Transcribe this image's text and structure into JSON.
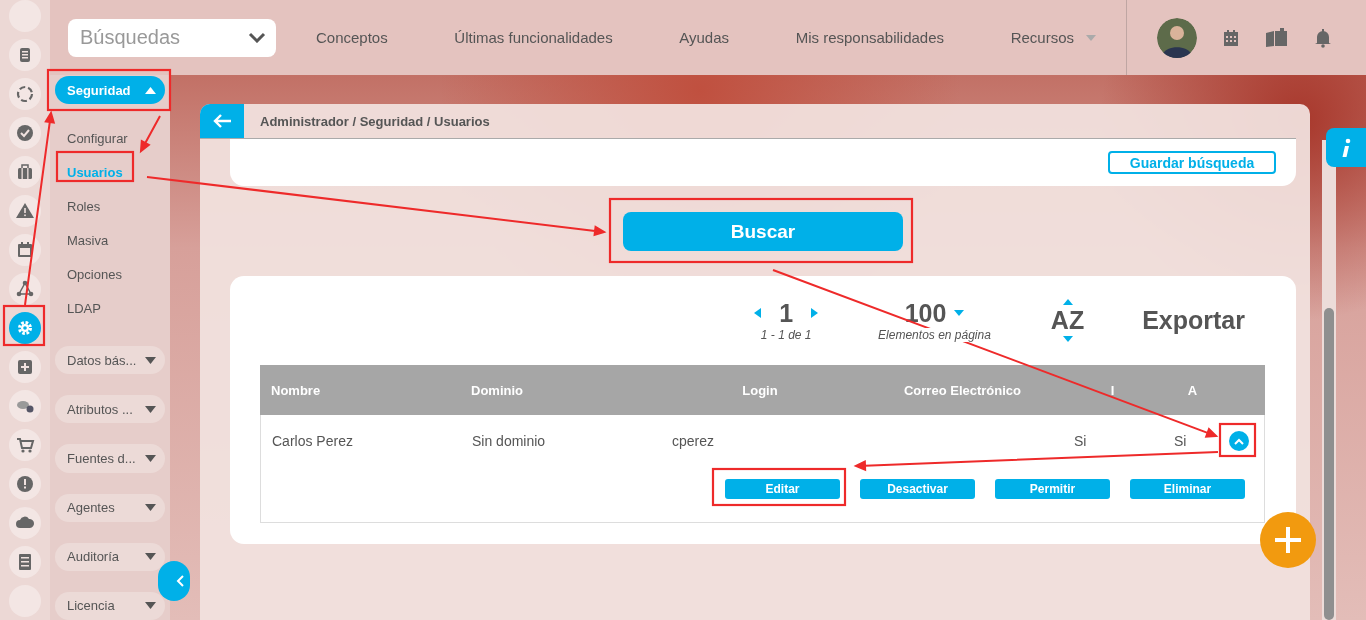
{
  "icon_rail": [
    {
      "selected": false
    },
    {
      "selected": false
    },
    {
      "selected": false
    },
    {
      "selected": false
    },
    {
      "selected": false
    },
    {
      "selected": false
    },
    {
      "selected": false
    },
    {
      "selected": false
    },
    {
      "selected": true
    },
    {
      "selected": false
    },
    {
      "selected": false
    },
    {
      "selected": false
    },
    {
      "selected": false
    },
    {
      "selected": false
    },
    {
      "selected": false
    },
    {
      "selected": false
    }
  ],
  "search": {
    "value": "Búsquedas"
  },
  "nav": [
    {
      "label": "Conceptos",
      "kind": "link"
    },
    {
      "label": "Últimas funcionalidades",
      "kind": "link"
    },
    {
      "label": "Ayudas",
      "kind": "link"
    },
    {
      "label": "Mis responsabilidades",
      "kind": "link"
    },
    {
      "label": "Recursos",
      "kind": "dropdown"
    }
  ],
  "menu": [
    {
      "label": "Seguridad",
      "expanded": true,
      "children": [
        {
          "label": "Configurar",
          "selected": false
        },
        {
          "label": "Usuarios",
          "selected": true
        },
        {
          "label": "Roles",
          "selected": false
        },
        {
          "label": "Masiva",
          "selected": false
        },
        {
          "label": "Opciones",
          "selected": false
        },
        {
          "label": "LDAP",
          "selected": false
        }
      ]
    },
    {
      "label": "Datos bás...",
      "expanded": false
    },
    {
      "label": "Atributos ...",
      "expanded": false
    },
    {
      "label": "Fuentes d...",
      "expanded": false
    },
    {
      "label": "Agentes",
      "expanded": false
    },
    {
      "label": "Auditoría",
      "expanded": false
    },
    {
      "label": "Licencia",
      "expanded": false
    }
  ],
  "breadcrumb": "Administrador / Seguridad / Usuarios",
  "save_search_button": "Guardar búsqueda",
  "search_button": "Buscar",
  "pager": {
    "page": "1",
    "range": "1 - 1 de 1"
  },
  "page_size": {
    "value": "100",
    "label": "Elementos en página"
  },
  "sort": "AZ",
  "export": "Exportar",
  "table": {
    "columns": [
      "Nombre",
      "Dominio",
      "Login",
      "Correo Electrónico",
      "I",
      "A"
    ],
    "rows": [
      {
        "nombre": "Carlos Perez",
        "dominio": "Sin dominio",
        "login": "cperez",
        "i": "Si",
        "a": "Si",
        "expanded": true,
        "actions": [
          "Editar",
          "Desactivar",
          "Permitir",
          "Eliminar"
        ]
      }
    ]
  }
}
